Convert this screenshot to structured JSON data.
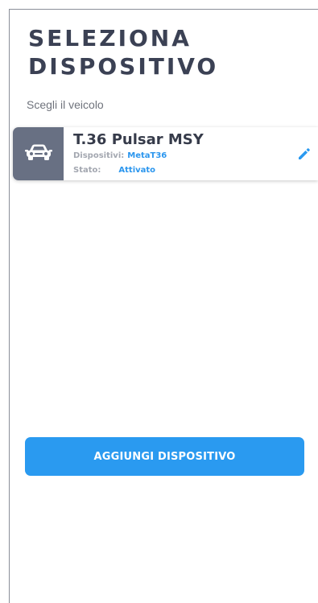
{
  "header": {
    "title_line1": "SELEZIONA",
    "title_line2": "DISPOSITIVO",
    "subtitle": "Scegli il veicolo"
  },
  "vehicles": [
    {
      "name": "T.36 Pulsar MSY",
      "devices_label": "Dispositivi:",
      "devices_value": "MetaT36",
      "status_label": "Stato:",
      "status_value": "Attivato",
      "icon": "car-icon",
      "action_icon": "edit-pencil-icon"
    }
  ],
  "actions": {
    "add_device_label": "AGGIUNGI DISPOSITIVO"
  },
  "colors": {
    "accent": "#2a9af0",
    "title": "#3b4154",
    "thumb_bg": "#687083"
  }
}
